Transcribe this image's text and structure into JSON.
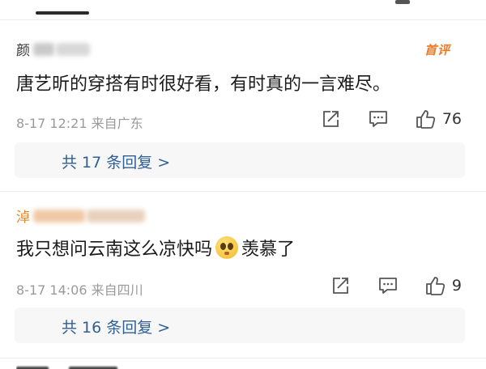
{
  "comments": [
    {
      "username": "颜",
      "badge": "首评",
      "text": "唐艺昕的穿搭有时很好看，有时真的一言难尽。",
      "meta": "8-17 12:21 来自广东",
      "likes": "76",
      "reply_link": "共 17 条回复 >"
    },
    {
      "username": "淖",
      "text_before": "我只想问云南这么凉快吗",
      "emoji": "pleading-face-emoji",
      "text_after": "羡慕了",
      "meta": "8-17 14:06 来自四川",
      "likes": "9",
      "reply_link": "共 16 条回复 >"
    }
  ],
  "colors": {
    "accent": "#ee7a25",
    "link": "#2f5f93",
    "meta": "#9a9a9a"
  }
}
